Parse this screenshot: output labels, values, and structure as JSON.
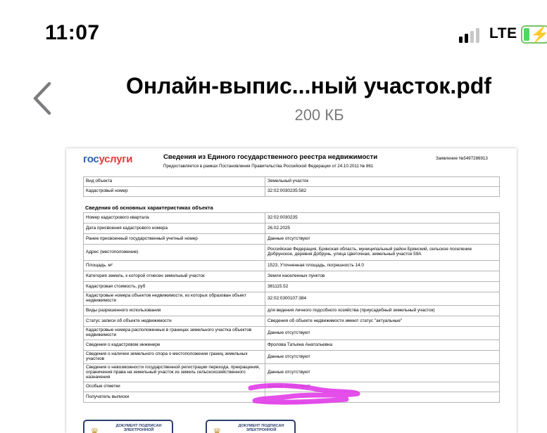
{
  "status_bar": {
    "time": "11:07",
    "network": "LTE",
    "signal_bars_active": 2,
    "signal_bars_total": 4,
    "battery": "charging"
  },
  "header": {
    "back_icon": "chevron-left-icon",
    "file_name": "Онлайн-выпис...ный участок.pdf",
    "file_size": "200 КБ"
  },
  "document": {
    "logo_part1": "гос",
    "logo_part2": "услуги",
    "title": "Сведения из Единого государственного реестра недвижимости",
    "subtitle": "Предоставляется в рамках Постановления Правительства Российской Федерации от 24.10.2011 № 861",
    "application": "Заявление №5497286913",
    "basic_rows": [
      {
        "label": "Вид объекта",
        "value": "Земельный участок"
      },
      {
        "label": "Кадастровый номер",
        "value": "32:02:0030235:582"
      }
    ],
    "section_title": "Сведения об основных характеристиках объекта",
    "characteristics": [
      {
        "label": "Номер кадастрового квартала",
        "value": "32:02:0030235"
      },
      {
        "label": "Дата присвоения кадастрового номера",
        "value": "26.02.2025"
      },
      {
        "label": "Ранее присвоенный государственный учетный номер",
        "value": "Данные отсутствуют"
      },
      {
        "label": "Адрес (местоположение)",
        "value": "Российская Федерация, Брянская область, муниципальный район Брянский, сельское поселение Добрунское, деревня Добрунь, улица Цветочная, земельный участок 59А"
      },
      {
        "label": "Площадь, м²",
        "value": "1523, Уточненная площадь, погрешность 14.0"
      },
      {
        "label": "Категория земель, к которой отнесен земельный участок",
        "value": "Земли населенных пунктов"
      },
      {
        "label": "Кадастровая стоимость, руб",
        "value": "381115.52"
      },
      {
        "label": "Кадастровые номера объектов недвижимости, из которых образован объект недвижимости",
        "value": "32:02:0300107:384"
      },
      {
        "label": "Виды разрешенного использования",
        "value": "для ведения личного подсобного хозяйства (приусадебный земельный участок)"
      },
      {
        "label": "Статус записи об объекте недвижимости",
        "value": "Сведения об объекте недвижимости имеют статус \"актуальные\""
      },
      {
        "label": "Кадастровые номера расположенных в границах земельного участка объектов недвижимости",
        "value": "Данные отсутствуют"
      },
      {
        "label": "Сведения о кадастровом инженере",
        "value": "Фролова Татьяна Анатольевна"
      },
      {
        "label": "Сведения о наличии земельного спора о местоположении границ земельных участков",
        "value": "Данные отсутствуют"
      },
      {
        "label": "Сведения о невозможности государственной регистрации перехода, прекращения, ограничения права на земельный участок из земель сельскохозяйственного назначения",
        "value": "Данные отсутствуют"
      },
      {
        "label": "Особые отметки",
        "value": "Данные отсутствуют"
      },
      {
        "label": "Получатель выписки",
        "value": ""
      }
    ],
    "stamp_text": "ДОКУМЕНТ ПОДПИСАН ЭЛЕКТРОННОЙ",
    "redaction_color": "#e13be8"
  }
}
